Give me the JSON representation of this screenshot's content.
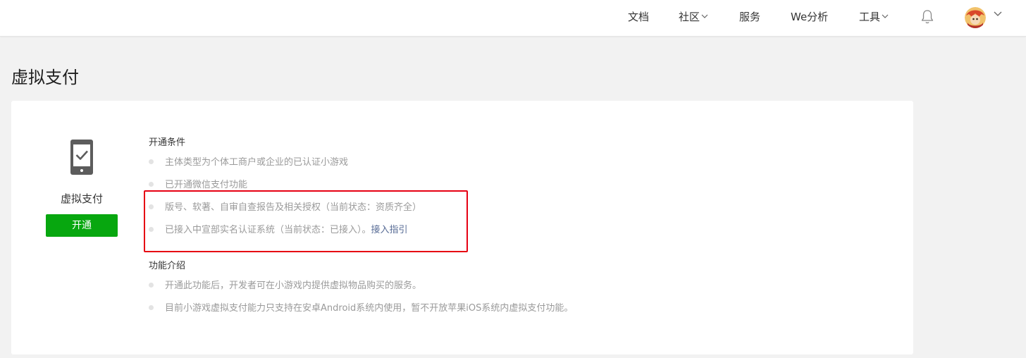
{
  "nav": {
    "docs": "文档",
    "community": "社区",
    "services": "服务",
    "we_analysis": "We分析",
    "tools": "工具"
  },
  "page": {
    "title": "虚拟支付"
  },
  "feature": {
    "name": "虚拟支付",
    "button_label": "开通",
    "accent_color": "#07a70f"
  },
  "conditions": {
    "title": "开通条件",
    "items": [
      "主体类型为个体工商户或企业的已认证小游戏",
      "已开通微信支付功能",
      "版号、软著、自审自查报告及相关授权（当前状态：资质齐全）",
      "已接入中宣部实名认证系统（当前状态：已接入）。"
    ],
    "guide_link": "接入指引"
  },
  "intro": {
    "title": "功能介绍",
    "items": [
      "开通此功能后，开发者可在小游戏内提供虚拟物品购买的服务。",
      "目前小游戏虚拟支付能力只支持在安卓Android系统内使用，暂不开放苹果iOS系统内虚拟支付功能。"
    ]
  },
  "icons": {
    "bell": "bell-icon",
    "avatar": "user-avatar",
    "device": "phone-check-icon",
    "chevron": "chevron-down-icon"
  },
  "highlight_color": "#e60012"
}
